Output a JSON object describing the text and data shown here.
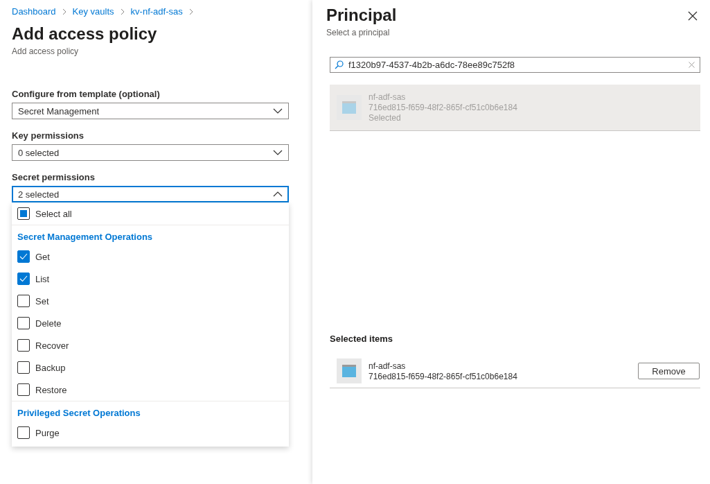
{
  "breadcrumb": [
    "Dashboard",
    "Key vaults",
    "kv-nf-adf-sas"
  ],
  "page": {
    "title": "Add access policy",
    "subtitle": "Add access policy"
  },
  "fields": [
    {
      "label": "Configure from template (optional)",
      "value": "Secret Management",
      "expanded": false
    },
    {
      "label": "Key permissions",
      "value": "0 selected",
      "expanded": false
    },
    {
      "label": "Secret permissions",
      "value": "2 selected",
      "expanded": true
    }
  ],
  "dropdown": {
    "select_all": {
      "label": "Select all",
      "checked": false,
      "indeterminate": true
    },
    "groups": [
      {
        "title": "Secret Management Operations",
        "options": [
          {
            "label": "Get",
            "checked": true
          },
          {
            "label": "List",
            "checked": true
          },
          {
            "label": "Set",
            "checked": false
          },
          {
            "label": "Delete",
            "checked": false
          },
          {
            "label": "Recover",
            "checked": false
          },
          {
            "label": "Backup",
            "checked": false
          },
          {
            "label": "Restore",
            "checked": false
          }
        ]
      },
      {
        "title": "Privileged Secret Operations",
        "options": [
          {
            "label": "Purge",
            "checked": false
          }
        ]
      }
    ]
  },
  "panel": {
    "title": "Principal",
    "subtitle": "Select a principal",
    "search": {
      "value": "f1320b97-4537-4b2b-a6dc-78ee89c752f8"
    },
    "results": [
      {
        "name": "nf-adf-sas",
        "id": "716ed815-f659-48f2-865f-cf51c0b6e184",
        "status": "Selected",
        "selected": true
      }
    ],
    "selected_heading": "Selected items",
    "selected_items": [
      {
        "name": "nf-adf-sas",
        "id": "716ed815-f659-48f2-865f-cf51c0b6e184",
        "button": "Remove"
      }
    ]
  }
}
